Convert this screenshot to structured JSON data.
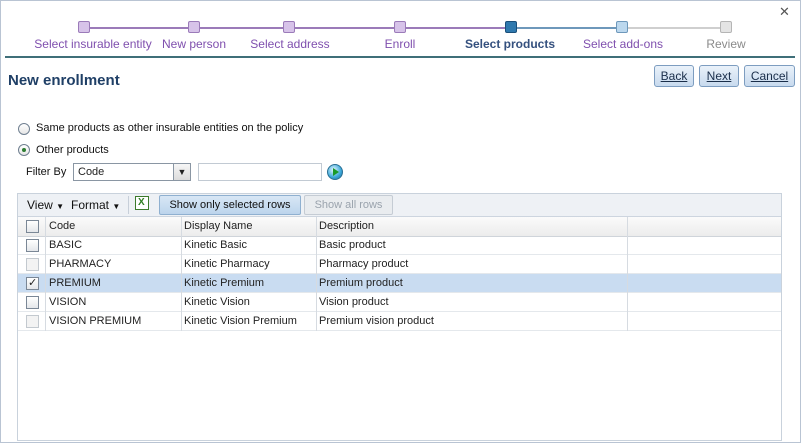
{
  "wizard": {
    "steps": [
      {
        "label": "Select insurable entity"
      },
      {
        "label": "New person"
      },
      {
        "label": "Select address"
      },
      {
        "label": "Enroll"
      },
      {
        "label": "Select products"
      },
      {
        "label": "Select add-ons"
      },
      {
        "label": "Review"
      }
    ],
    "current_step": "Select products",
    "colors": {
      "done": "#9b7bb9",
      "current": "#2f79ae",
      "upcoming": "#bcd8ee",
      "future": "#e4e4e4"
    }
  },
  "header": {
    "title": "New enrollment",
    "back_label": "Back",
    "next_label": "Next",
    "cancel_label": "Cancel"
  },
  "close_icon": "close-icon",
  "options": {
    "same_products_label": "Same products as other insurable entities on the policy",
    "other_products_label": "Other products",
    "selected": "Other products"
  },
  "filter": {
    "label": "Filter By",
    "selected_field": "Code",
    "value": "",
    "go_icon": "go-arrow-icon"
  },
  "toolbar": {
    "view_label": "View",
    "format_label": "Format",
    "export_icon": "excel-export-icon",
    "show_selected_label": "Show only selected rows",
    "show_all_label": "Show all rows"
  },
  "table": {
    "columns": [
      "Code",
      "Display Name",
      "Description"
    ],
    "rows": [
      {
        "code": "BASIC",
        "display_name": "Kinetic Basic",
        "description": "Basic product",
        "checked": false,
        "enabled": true,
        "selected": false
      },
      {
        "code": "PHARMACY",
        "display_name": "Kinetic Pharmacy",
        "description": "Pharmacy product",
        "checked": false,
        "enabled": false,
        "selected": false
      },
      {
        "code": "PREMIUM",
        "display_name": "Kinetic Premium",
        "description": "Premium product",
        "checked": true,
        "enabled": true,
        "selected": true
      },
      {
        "code": "VISION",
        "display_name": "Kinetic Vision",
        "description": "Vision product",
        "checked": false,
        "enabled": true,
        "selected": false
      },
      {
        "code": "VISION PREMIUM",
        "display_name": "Kinetic Vision Premium",
        "description": "Premium vision product",
        "checked": false,
        "enabled": false,
        "selected": false
      }
    ]
  }
}
